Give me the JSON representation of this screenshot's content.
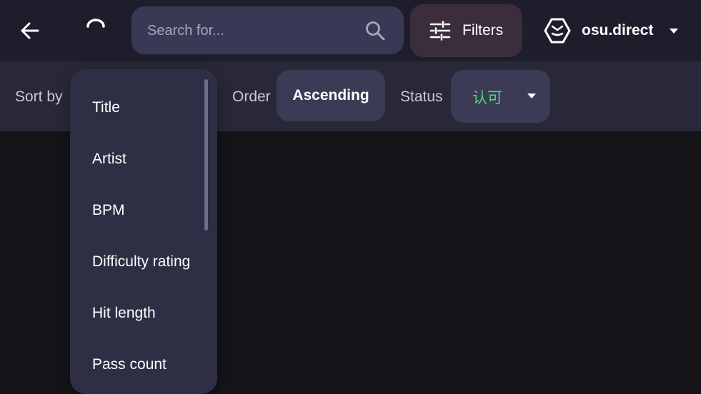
{
  "topbar": {
    "search": {
      "placeholder": "Search for...",
      "value": ""
    },
    "filters_label": "Filters",
    "server_name": "osu.direct"
  },
  "sortbar": {
    "sort_by_label": "Sort by",
    "order_label": "Order",
    "order_value": "Ascending",
    "status_label": "Status",
    "status_value": "认可"
  },
  "sort_dropdown": {
    "items": [
      "Title",
      "Artist",
      "BPM",
      "Difficulty rating",
      "Hit length",
      "Pass count"
    ]
  },
  "colors": {
    "background": "#141419",
    "topbar": "#1d1d2c",
    "sortbar": "#282838",
    "surface": "#3b3b56",
    "filters_button": "#3b2d3b",
    "status_value": "#4fd77a"
  },
  "icons": {
    "back": "arrow-left-icon",
    "loading": "spinner-icon",
    "search": "search-icon",
    "filters": "sliders-icon",
    "server": "osu-direct-logo-icon",
    "dropdown": "caret-down-icon"
  }
}
